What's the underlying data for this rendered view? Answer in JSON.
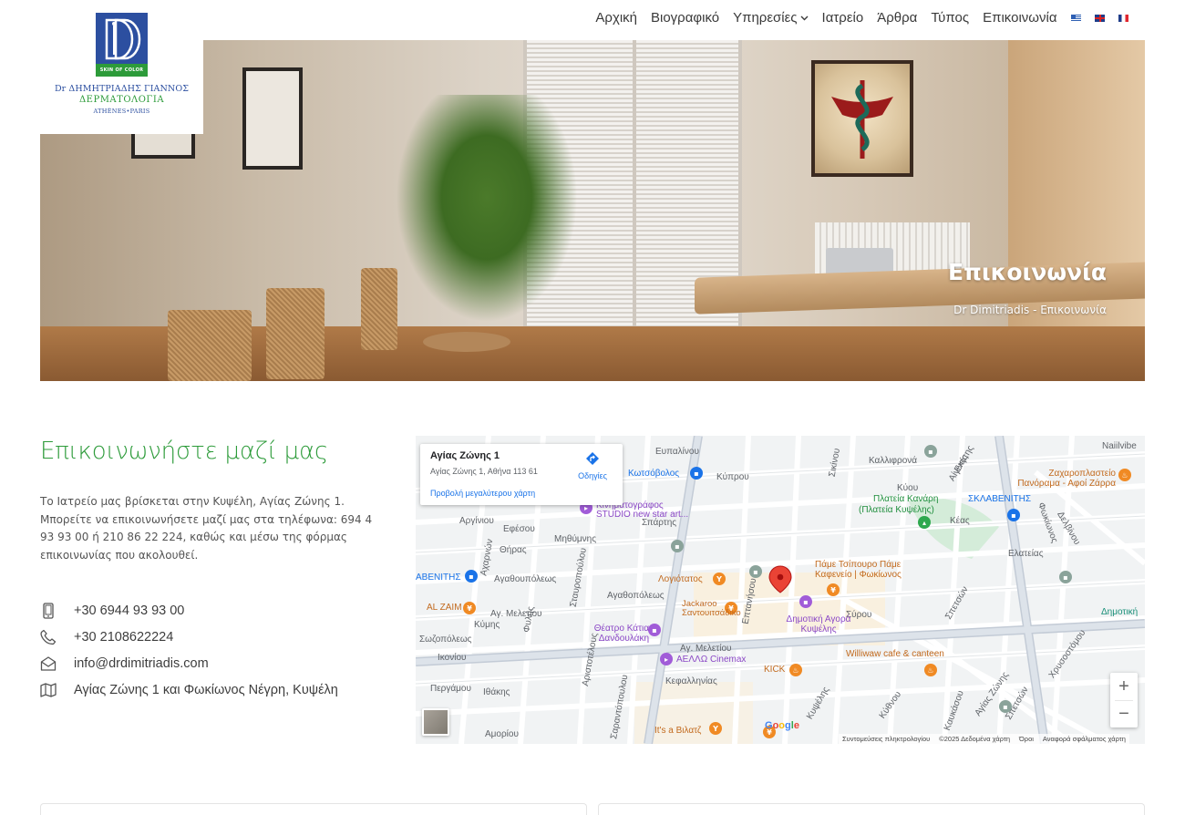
{
  "logo": {
    "badge_text": "SKIN OF COLOR",
    "doctor_name": "Dr ΔΗΜΗΤΡΙΑΔΗΣ ΓΙΑΝΝΟΣ",
    "specialty": "ΔΕΡΜΑΤΟΛΟΓΙΑ",
    "cities": "ATHÈNES•PARIS"
  },
  "nav": {
    "items": [
      {
        "label": "Αρχική"
      },
      {
        "label": "Βιογραφικό"
      },
      {
        "label": "Υπηρεσίες",
        "has_dropdown": true
      },
      {
        "label": "Ιατρείο"
      },
      {
        "label": "Άρθρα"
      },
      {
        "label": "Τύπος"
      },
      {
        "label": "Επικοινωνία"
      }
    ],
    "languages": [
      "gr-flag-icon",
      "en-flag-icon",
      "fr-flag-icon"
    ]
  },
  "hero": {
    "title": "Επικοινωνία",
    "breadcrumb_home": "Dr Dimitriadis",
    "breadcrumb_sep": " - ",
    "breadcrumb_current": "Επικοινωνία"
  },
  "contact": {
    "title": "Επικοινωνήστε μαζί μας",
    "text": "Το Ιατρείο μας βρίσκεται στην Κυψέλη, Αγίας Ζώνης 1. Μπορείτε να επικοινωνήσετε μαζί μας στα τηλέφωνα: 694 4 93 93 00 ή 210 86 22 224, καθώς και μέσω της φόρμας επικοινωνίας που ακολουθεί.",
    "mobile": "+30 6944 93 93 00",
    "phone": "+30 2108622224",
    "email": "info@drdimitriadis.com",
    "address": "Αγίας Ζώνης 1 και Φωκίωνος Νέγρη, Κυψέλη"
  },
  "map": {
    "place_name": "Αγίας Ζώνης 1",
    "place_address": "Αγίας Ζώνης 1, Αθήνα 113 61",
    "directions_label": "Οδηγίες",
    "larger_map_label": "Προβολή μεγαλύτερου χάρτη",
    "zoom_in": "+",
    "zoom_out": "−",
    "google_letters": [
      "G",
      "o",
      "o",
      "g",
      "l",
      "e"
    ],
    "attribution": [
      "Συντομεύσεις πληκτρολογίου",
      "©2025 Δεδομένα χάρτη",
      "Όροι",
      "Αναφορά σφάλματος χάρτη"
    ],
    "streets": [
      "Ευπαλίνου",
      "Κύπρου",
      "Καλλιφρονά",
      "Πλατεία Κανάρη",
      "(Πλατεία Κυψέλης)",
      "Αργίνιου",
      "Εφέσου",
      "Σπάρτης",
      "Θήρας",
      "Μηθύμνης",
      "Αγαθουπόλεως",
      "Αγαθοπόλεως",
      "Αγ. Μελετίου",
      "Κύμης",
      "Σωζοπόλεως",
      "Ικονίου",
      "Περγάμου",
      "Ιθάκης",
      "Αμορίου",
      "Κεφαλληνίας",
      "Σύρου",
      "Επτανήσου",
      "Σπετσών",
      "Ελατείας",
      "Φωκίωνος",
      "Δελβίνου",
      "Σικίνου",
      "Κύθνου",
      "Κέας",
      "Κυψέλης",
      "Αίγινης",
      "Αγίας Ζώνης",
      "Χρυσοστόμου",
      "Κύου",
      "Αριστοτέλους",
      "Φυλής",
      "Σταυροπούλου",
      "Αχαρνών",
      "Σαραντόπουλου",
      "Αγ. Μελετίου",
      "Εκάτης",
      "Σπετσών",
      "Καυκάσου",
      "Νaiilvibe"
    ],
    "pois": [
      {
        "name": "Κωτσόβολος",
        "color": "blue"
      },
      {
        "name": "Κινηματογράφος STUDIO new star art...",
        "color": "purple"
      },
      {
        "name": "ΣΚΛΑΒΕΝΙΤΗΣ",
        "color": "blue"
      },
      {
        "name": "Ζαχαροπλαστείο Πανόραμα - Αφοί Ζάρρα",
        "color": "orange"
      },
      {
        "name": "ΑΒΕΝΙΤΗΣ",
        "color": "blue"
      },
      {
        "name": "Λογιότατος",
        "color": "orange"
      },
      {
        "name": "Πάμε Τσίπουρο Πάμε Καφενείο | Φωκίωνος",
        "color": "orange"
      },
      {
        "name": "AL ZAIM",
        "color": "orange"
      },
      {
        "name": "Jackaroo Σαντουιτσάδικο",
        "color": "orange"
      },
      {
        "name": "Δημοτική Αγορά Κυψέλης",
        "color": "purple"
      },
      {
        "name": "Θέατρο Κάτια Δανδουλάκη",
        "color": "purple"
      },
      {
        "name": "ΑΕΛΛΩ Cinemax",
        "color": "purple"
      },
      {
        "name": "KICK",
        "color": "orange"
      },
      {
        "name": "Williwaw cafe & canteen",
        "color": "orange"
      },
      {
        "name": "Δημοτική",
        "color": "teal"
      },
      {
        "name": "It's a Βιλατζ",
        "color": "orange"
      }
    ]
  },
  "colors": {
    "brand_green": "#2d9b3a",
    "brand_blue": "#2c4fa0",
    "map_blue": "#1a73e8"
  }
}
